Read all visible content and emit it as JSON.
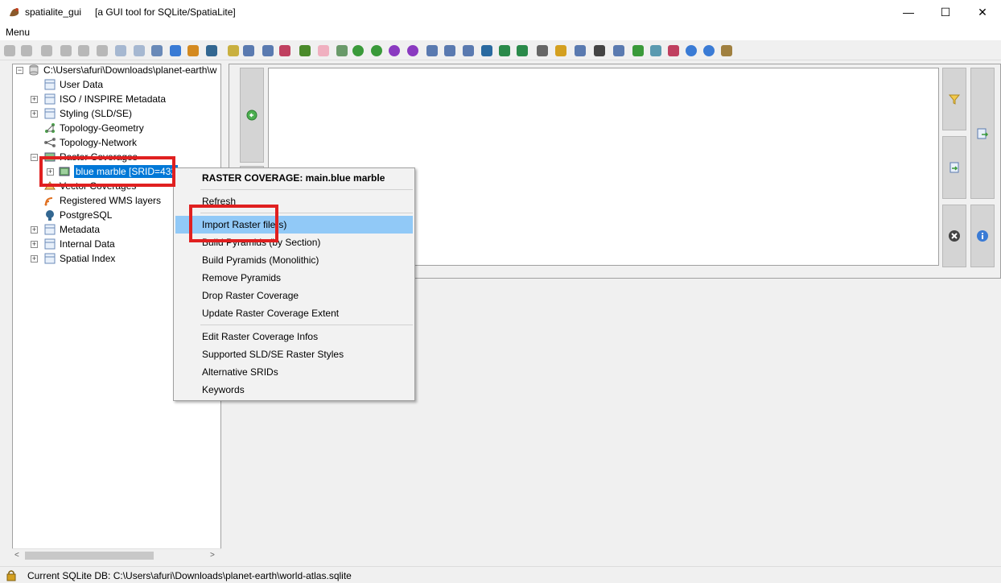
{
  "window": {
    "title": "spatialite_gui",
    "subtitle": "[a GUI tool for SQLite/SpatiaLite]",
    "minimize": "—",
    "maximize": "☐",
    "close": "✕"
  },
  "menubar": {
    "menu_label": "Menu"
  },
  "toolbar": {
    "icons": [
      "connect-icon",
      "create-db-icon",
      "disconnect-icon",
      "memory-db-icon",
      "memory-save-icon",
      "memory-load-icon",
      "export-icon",
      "vacuum-icon",
      "attach-icon",
      "sql-script-icon",
      "load-shp-icon",
      "postgres-icon",
      "load-txt-icon",
      "query-composer-icon",
      "map-icon",
      "charts-icon",
      "bug-icon",
      "checkgeom-icon",
      "sanitize-icon",
      "globe-green-icon",
      "globe-blue-icon",
      "globe-purple-icon",
      "globe-violet-icon",
      "doc-icon",
      "doc2-icon",
      "doc3-icon",
      "doc4-icon",
      "excel-icon",
      "excel2-icon",
      "eye-icon",
      "table-icon",
      "grid-icon",
      "list-icon",
      "wms-icon",
      "raster-icon",
      "dbf-icon",
      "font-icon",
      "help-icon",
      "about-icon",
      "exit-icon"
    ]
  },
  "tree": {
    "root": "C:\\Users\\afuri\\Downloads\\planet-earth\\w",
    "items": [
      {
        "label": "User Data"
      },
      {
        "label": "ISO / INSPIRE Metadata"
      },
      {
        "label": "Styling (SLD/SE)"
      },
      {
        "label": "Topology-Geometry"
      },
      {
        "label": "Topology-Network"
      },
      {
        "label": "Raster Coverages"
      },
      {
        "label": "blue marble [SRID=432"
      },
      {
        "label": "Vector Coverages"
      },
      {
        "label": "Registered WMS layers"
      },
      {
        "label": "PostgreSQL"
      },
      {
        "label": "Metadata"
      },
      {
        "label": "Internal Data"
      },
      {
        "label": "Spatial Index"
      }
    ],
    "scroll_left": "<",
    "scroll_right": ">"
  },
  "context_menu": {
    "header": "RASTER COVERAGE: main.blue marble",
    "items": [
      "Refresh",
      "Import Raster file(s)",
      "Build Pyramids (by Section)",
      "Build Pyramids (Monolithic)",
      "Remove Pyramids",
      "Drop Raster Coverage",
      "Update Raster Coverage Extent",
      "Edit Raster Coverage Infos",
      "Supported SLD/SE Raster Styles",
      "Alternative SRIDs",
      "Keywords"
    ]
  },
  "statusbar": {
    "text": "Current SQLite DB: C:\\Users\\afuri\\Downloads\\planet-earth\\world-atlas.sqlite"
  },
  "colors": {
    "highlight": "#91c9f7",
    "selection": "#0078d7",
    "annotation": "#e02020"
  }
}
